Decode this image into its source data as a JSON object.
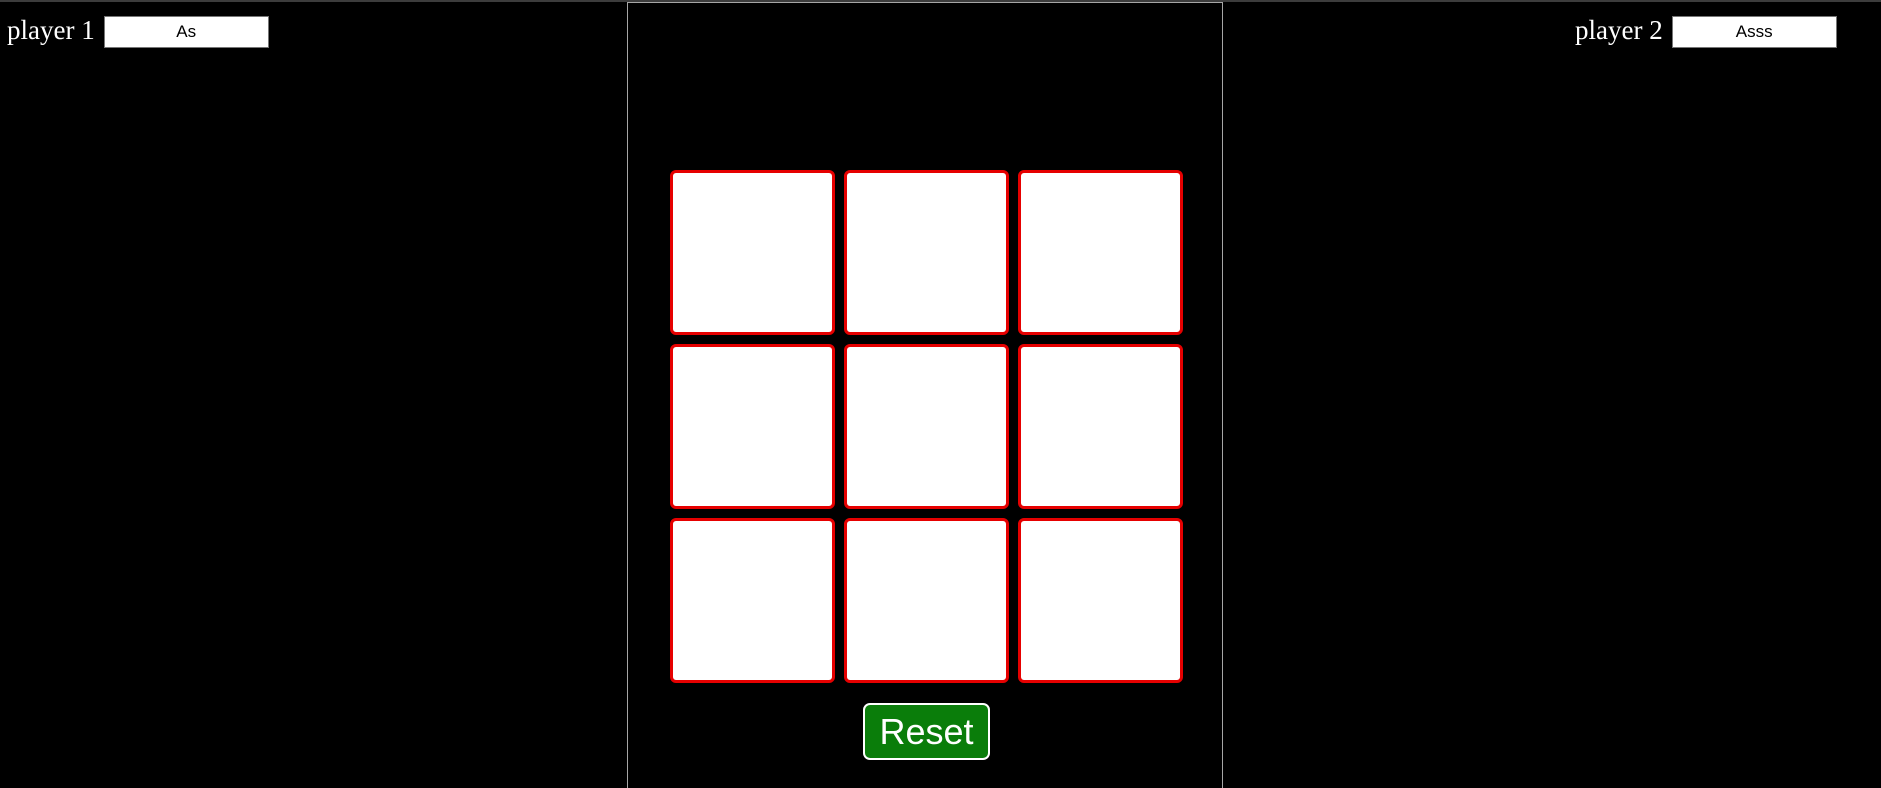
{
  "players": {
    "player1": {
      "label": "player 1",
      "name": "As"
    },
    "player2": {
      "label": "player 2",
      "name": "Asss"
    }
  },
  "board": {
    "cells": [
      "",
      "",
      "",
      "",
      "",
      "",
      "",
      "",
      ""
    ]
  },
  "controls": {
    "reset_label": "Reset"
  },
  "colors": {
    "background": "#000000",
    "cell_background": "#ffffff",
    "cell_border": "#e60000",
    "reset_button": "#0a7d0a",
    "panel_border": "#a6a6a6"
  }
}
